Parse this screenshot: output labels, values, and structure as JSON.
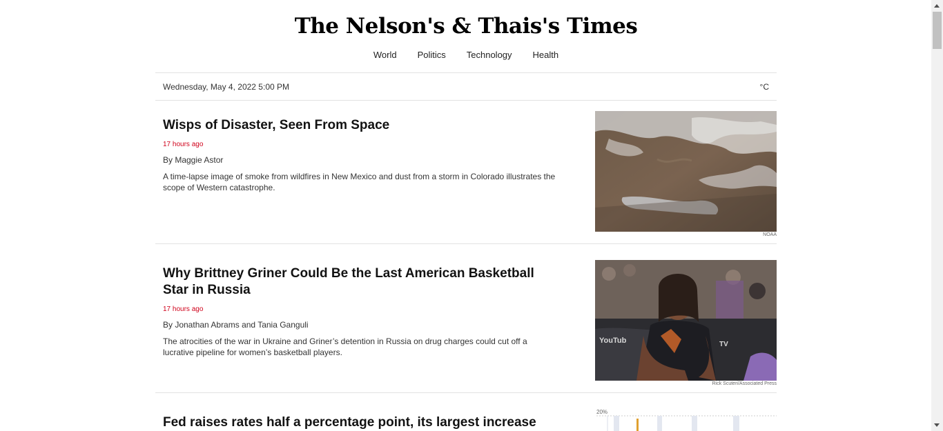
{
  "masthead": {
    "title": "The Nelson's & Thais's Times"
  },
  "nav": {
    "items": [
      "World",
      "Politics",
      "Technology",
      "Health"
    ]
  },
  "dateline": {
    "date": "Wednesday, May 4, 2022 5:00 PM",
    "temperature_unit": "°C"
  },
  "articles": [
    {
      "headline": "Wisps of Disaster, Seen From Space",
      "timestamp": "17 hours ago",
      "byline": "By Maggie Astor",
      "summary": "A time-lapse image of smoke from wildfires in New Mexico and dust from a storm in Colorado illustrates the scope of Western catastrophe.",
      "photo_credit": "NOAA"
    },
    {
      "headline": "Why Brittney Griner Could Be the Last American Basketball Star in Russia",
      "timestamp": "17 hours ago",
      "byline": "By Jonathan Abrams and Tania Ganguli",
      "summary": "The atrocities of the war in Ukraine and Griner’s detention in Russia on drug charges could cut off a lucrative pipeline for women’s basketball players.",
      "photo_credit": "Rick Scuteri/Associated Press"
    },
    {
      "headline": "Fed raises rates half a percentage point, its largest increase since",
      "chart_label": "20%"
    }
  ],
  "colors": {
    "timestamp": "#d0021b",
    "rule": "#e2e2e2",
    "scrollbar_thumb": "#c1c1c1"
  }
}
